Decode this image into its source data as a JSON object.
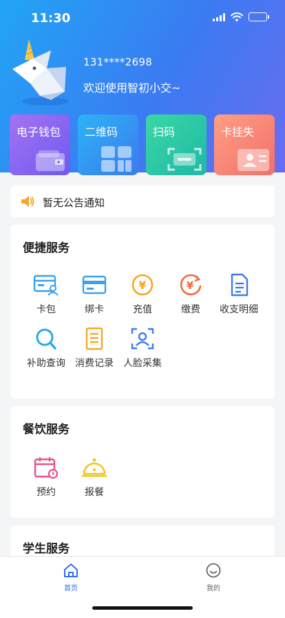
{
  "status_bar": {
    "time": "11:30"
  },
  "user": {
    "phone": "131****2698",
    "welcome": "欢迎使用智初小交~"
  },
  "cards": [
    {
      "label": "电子钱包",
      "icon": "wallet-icon"
    },
    {
      "label": "二维码",
      "icon": "qrcode-icon"
    },
    {
      "label": "扫码",
      "icon": "scan-icon"
    },
    {
      "label": "卡挂失",
      "icon": "id-card-icon"
    }
  ],
  "notice": {
    "text": "暂无公告通知",
    "icon": "speaker-icon"
  },
  "sections": {
    "convenience": {
      "title": "便捷服务",
      "items": [
        {
          "label": "卡包",
          "icon": "card-bag-icon"
        },
        {
          "label": "绑卡",
          "icon": "bind-card-icon"
        },
        {
          "label": "充值",
          "icon": "recharge-icon"
        },
        {
          "label": "缴费",
          "icon": "payment-icon"
        },
        {
          "label": "收支明细",
          "icon": "statement-icon"
        },
        {
          "label": "补助查询",
          "icon": "search-icon"
        },
        {
          "label": "消费记录",
          "icon": "record-icon"
        },
        {
          "label": "人脸采集",
          "icon": "face-scan-icon"
        }
      ]
    },
    "dining": {
      "title": "餐饮服务",
      "items": [
        {
          "label": "预约",
          "icon": "calendar-icon"
        },
        {
          "label": "报餐",
          "icon": "meal-bell-icon"
        }
      ]
    },
    "student": {
      "title": "学生服务"
    }
  },
  "tabbar": [
    {
      "label": "首页",
      "icon": "home-icon",
      "active": true
    },
    {
      "label": "我的",
      "icon": "smiley-icon",
      "active": false
    }
  ],
  "colors": {
    "accent": "#3b7bf2",
    "tab_active": "#2f6fe8",
    "tab_inactive": "#666666"
  }
}
